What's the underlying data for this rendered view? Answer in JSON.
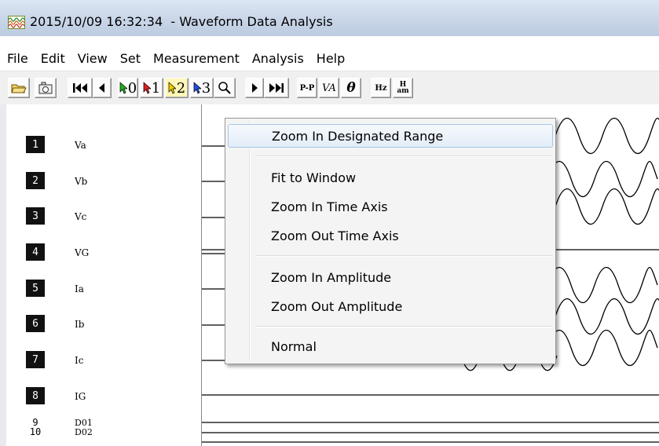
{
  "window": {
    "title": "2015/10/09 16:32:34  - Waveform Data Analysis"
  },
  "menu": [
    "File",
    "Edit",
    "View",
    "Set",
    "Measurement",
    "Analysis",
    "Help"
  ],
  "toolbar": {
    "cursor_labels": [
      "0",
      "1",
      "2",
      "3"
    ],
    "icons": [
      "open-folder-icon",
      "camera-icon",
      "rewind-icon",
      "step-back-icon",
      "cursor-0-icon",
      "cursor-1-icon",
      "cursor-2-icon",
      "cursor-3-icon",
      "magnifier-icon",
      "step-forward-icon",
      "fast-forward-icon",
      "peak-to-peak-icon",
      "voltage-amplitude-icon",
      "theta-icon",
      "hz-icon",
      "harmonic-icon"
    ],
    "pp_label": "P-P",
    "va_label": "VA",
    "theta_label": "θ",
    "hz_label": "Hz",
    "ham_label_top": "H",
    "ham_label_bottom": "am"
  },
  "channels": [
    {
      "num": "1",
      "label": "Va"
    },
    {
      "num": "2",
      "label": "Vb"
    },
    {
      "num": "3",
      "label": "Vc"
    },
    {
      "num": "4",
      "label": "VG"
    },
    {
      "num": "5",
      "label": "Ia"
    },
    {
      "num": "6",
      "label": "Ib"
    },
    {
      "num": "7",
      "label": "Ic"
    },
    {
      "num": "8",
      "label": "IG"
    }
  ],
  "digital_channels": [
    {
      "num": "9",
      "label": "D01"
    },
    {
      "num": "10",
      "label": "D02"
    }
  ],
  "context_menu": {
    "items": [
      {
        "label": "Zoom In Designated Range",
        "highlighted": true
      },
      {
        "label": "Fit to Window"
      },
      {
        "label": "Zoom In Time Axis"
      },
      {
        "label": "Zoom Out Time Axis"
      },
      {
        "label": "Zoom In Amplitude"
      },
      {
        "label": "Zoom Out Amplitude"
      },
      {
        "label": "Normal"
      }
    ]
  },
  "colors": {
    "badge": "#111111",
    "highlight": "#e3edf8",
    "cursor_pressed": "#fff6b8"
  }
}
